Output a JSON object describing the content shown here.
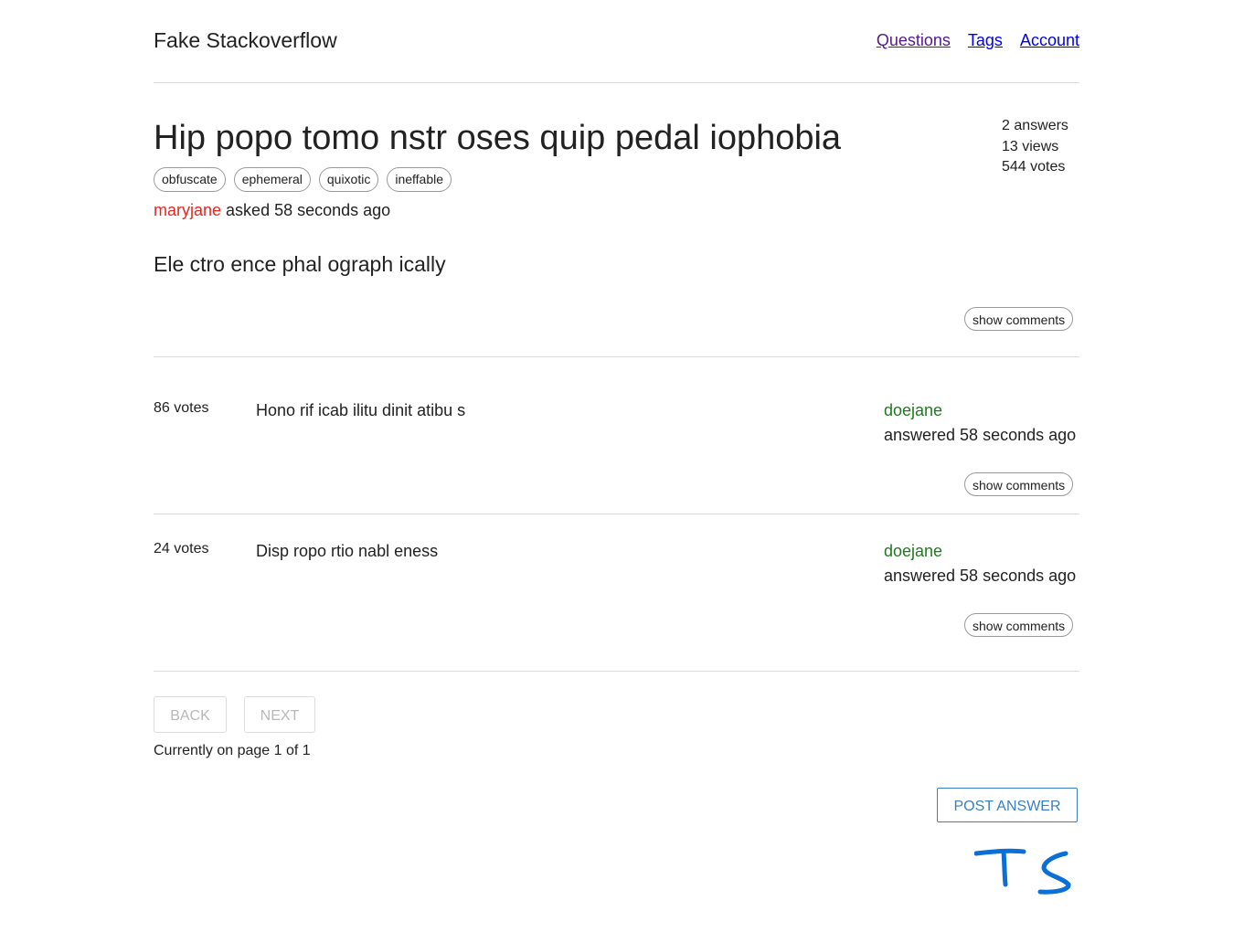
{
  "header": {
    "brand": "Fake Stackoverflow",
    "nav": [
      "Questions",
      "Tags",
      "Account"
    ]
  },
  "question": {
    "title": "Hip popo tomo nstr oses quip pedal iophobia",
    "stats": {
      "answers": "2 answers",
      "views": "13 views",
      "votes": "544 votes"
    },
    "tags": [
      "obfuscate",
      "ephemeral",
      "quixotic",
      "ineffable"
    ],
    "author": "maryjane",
    "asked": "asked 58 seconds ago",
    "body": "Ele ctro ence phal ograph ically",
    "show_comments": "show comments"
  },
  "answers": [
    {
      "votes": "86 votes",
      "text": "Hono rif icab ilitu dinit atibu s",
      "author": "doejane",
      "when": "answered 58 seconds ago",
      "show_comments": "show comments"
    },
    {
      "votes": "24 votes",
      "text": "Disp ropo rtio nabl eness",
      "author": "doejane",
      "when": "answered 58 seconds ago",
      "show_comments": "show comments"
    }
  ],
  "pagination": {
    "back": "BACK",
    "next": "NEXT",
    "info": "Currently on page 1 of 1"
  },
  "post_answer": "POST ANSWER",
  "handwritten_mark": "TS",
  "colors": {
    "author_question": "#e8261f",
    "author_answer": "#1f7a1f",
    "accent": "#3a7fc4",
    "mark": "#0a6fd6"
  }
}
